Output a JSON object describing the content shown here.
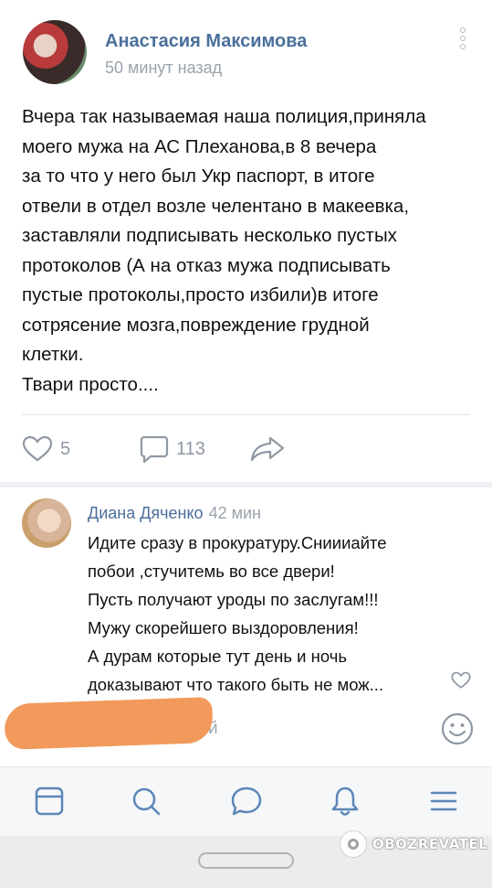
{
  "post": {
    "author": "Анастасия Максимова",
    "time": "50 минут назад",
    "text": "Вчера так называемая наша полиция,приняла\nмоего мужа на АС Плеханова,в 8 вечера\nза то что у него был Укр паспорт, в итоге\nотвели в отдел возле челентано в макеевка,\nзаставляли подписывать несколько пустых\nпротоколов (А на отказ мужа подписывать\nпустые протоколы,просто избили)в итоге\nсотрясение мозга,повреждение грудной\nклетки.\nТвари просто....",
    "likes": "5",
    "comments": "113"
  },
  "comment": {
    "author": "Диана Дяченко",
    "time": "42 мин",
    "text": "Идите сразу в прокуратуру.Сниииайте\nпобои ,стучитемь во все двери!\nПусть получают уроды по заслугам!!!\nМужу скорейшего выздоровления!\nА дурам которые тут день и ночь\nдоказывают что такого быть не мож..."
  },
  "reply": {
    "placeholder_visible": "й"
  },
  "watermark": "OBOZREVATEL",
  "icons": {
    "like": "heart-icon",
    "comment": "comment-bubble-icon",
    "share": "share-arrow-icon",
    "emoji": "smiley-icon",
    "tabs": [
      "news-feed-icon",
      "search-icon",
      "messages-icon",
      "notifications-bell-icon",
      "menu-icon"
    ]
  },
  "colors": {
    "accent": "#4a6f9a",
    "icon_gray": "#8f98a3",
    "tab_icon": "#5b86b8"
  }
}
